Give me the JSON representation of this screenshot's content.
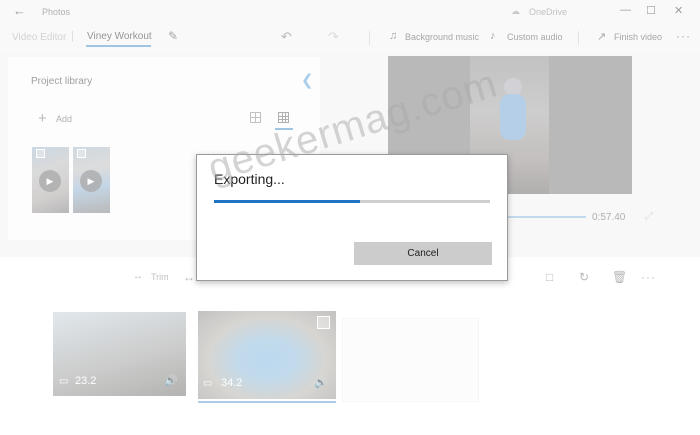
{
  "app": {
    "title": "Photos",
    "onedrive": "OneDrive"
  },
  "toolbar": {
    "breadcrumb_root": "Video Editor",
    "breadcrumb_separator": "|",
    "project_name": "Viney Workout",
    "background_music": "Background music",
    "custom_audio": "Custom audio",
    "finish_video": "Finish video",
    "more": "···"
  },
  "library": {
    "title": "Project library",
    "add_label": "Add",
    "add_icon": "+",
    "thumbnails": [
      {
        "icon": "play-icon",
        "play": "▶"
      },
      {
        "icon": "play-icon",
        "play": "▶"
      }
    ]
  },
  "preview": {
    "time": "0:57.40",
    "progress": 0.6
  },
  "storyboard": {
    "trim_label": "Trim",
    "clips": [
      {
        "duration": "23.2",
        "selected": false
      },
      {
        "duration": "34.2",
        "selected": true
      }
    ]
  },
  "dialog": {
    "title": "Exporting...",
    "progress": 0.53,
    "cancel_label": "Cancel"
  },
  "watermark": "geekermag.com",
  "colors": {
    "accent": "#1f74c4",
    "selection": "#5aa0d8",
    "button": "#cccccc"
  }
}
